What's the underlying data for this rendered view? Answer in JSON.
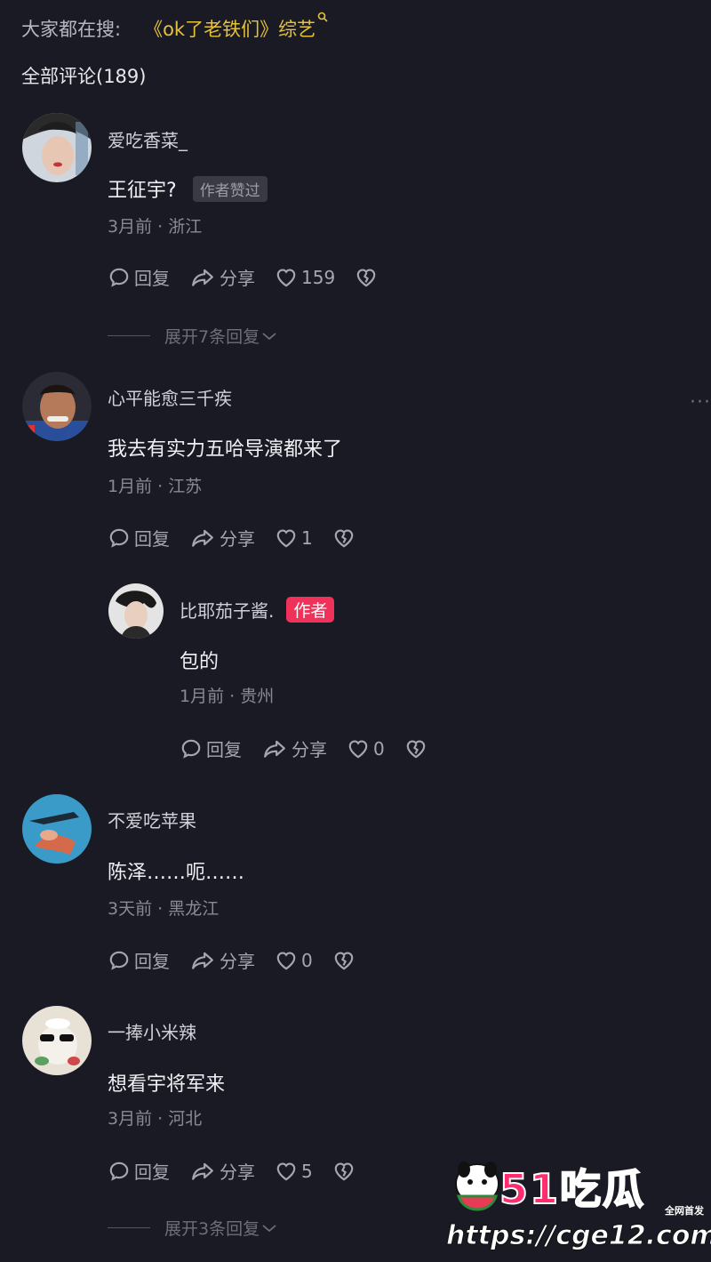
{
  "search": {
    "label": "大家都在搜:",
    "topic": "《ok了老铁们》综艺"
  },
  "comments_header": "全部评论(189)",
  "comments": [
    {
      "username": "爱吃香菜_",
      "text": "王征宇?",
      "tag": "作者赞过",
      "meta": "3月前 · 浙江",
      "reply_label": "回复",
      "share_label": "分享",
      "likes": "159",
      "expand": "展开7条回复"
    },
    {
      "username": "心平能愈三千疾",
      "text": "我去有实力五哈导演都来了",
      "meta": "1月前 · 江苏",
      "reply_label": "回复",
      "share_label": "分享",
      "likes": "1",
      "more": "···"
    },
    {
      "username": "比耶茄子酱.",
      "author_tag": "作者",
      "text": "包的",
      "meta": "1月前 · 贵州",
      "reply_label": "回复",
      "share_label": "分享",
      "likes": "0"
    },
    {
      "username": "不爱吃苹果",
      "text": "陈泽……呃……",
      "meta": "3天前 · 黑龙江",
      "reply_label": "回复",
      "share_label": "分享",
      "likes": "0"
    },
    {
      "username": "一捧小米辣",
      "text": "想看宇将军来",
      "meta": "3月前 · 河北",
      "reply_label": "回复",
      "share_label": "分享",
      "likes": "5",
      "expand": "展开3条回复"
    }
  ],
  "watermark": {
    "brand": "51吃瓜",
    "tag": "全网首发",
    "url": "https://cge12.com"
  },
  "colors": {
    "background": "#1a1a24",
    "search_topic": "#e6c23a",
    "author_tag": "#f0315a"
  }
}
